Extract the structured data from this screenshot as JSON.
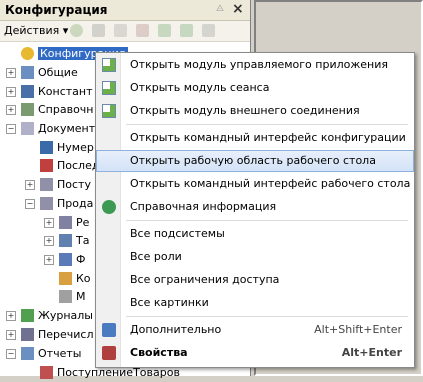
{
  "panel": {
    "title": "Конфигурация",
    "pin": "⨺",
    "close": "×",
    "actions_label": "Действия ▾"
  },
  "tree": [
    {
      "label": "Конфигурация",
      "icon": "config-icon",
      "selected": true
    },
    {
      "label": "Общие",
      "icon": "common-icon"
    },
    {
      "label": "Констант",
      "icon": "constants-icon"
    },
    {
      "label": "Справочн",
      "icon": "catalogs-icon"
    },
    {
      "label": "Документ",
      "icon": "documents-icon"
    },
    {
      "label": "Нумер",
      "icon": "numerator-icon"
    },
    {
      "label": "Послед",
      "icon": "sequence-icon"
    },
    {
      "label": "Посту",
      "icon": "document-icon"
    },
    {
      "label": "Прода",
      "icon": "document-icon"
    },
    {
      "label": "Ре",
      "icon": "attribute-icon"
    },
    {
      "label": "Та",
      "icon": "table-icon"
    },
    {
      "label": "Ф",
      "icon": "form-icon"
    },
    {
      "label": "Ко",
      "icon": "command-icon"
    },
    {
      "label": "М",
      "icon": "layout-icon"
    },
    {
      "label": "Журналы",
      "icon": "journal-icon"
    },
    {
      "label": "Перечисл",
      "icon": "enum-icon"
    },
    {
      "label": "Отчеты",
      "icon": "reports-icon"
    },
    {
      "label": "ПоступлениеТоваров",
      "icon": "report-icon"
    }
  ],
  "menu": {
    "items": [
      {
        "label": "Открыть модуль управляемого приложения",
        "icon": "module-icon"
      },
      {
        "label": "Открыть модуль сеанса",
        "icon": "module-icon"
      },
      {
        "label": "Открыть модуль внешнего соединения",
        "icon": "module-icon"
      },
      {
        "label": "Открыть командный интерфейс конфигурации"
      },
      {
        "label": "Открыть рабочую область рабочего стола",
        "highlighted": true
      },
      {
        "label": "Открыть командный интерфейс рабочего стола"
      },
      {
        "label": "Справочная информация",
        "icon": "help-icon"
      },
      {
        "label": "Все подсистемы"
      },
      {
        "label": "Все роли"
      },
      {
        "label": "Все ограничения доступа"
      },
      {
        "label": "Все картинки"
      },
      {
        "label": "Дополнительно",
        "icon": "advanced-icon",
        "shortcut": "Alt+Shift+Enter"
      },
      {
        "label": "Свойства",
        "icon": "properties-icon",
        "shortcut": "Alt+Enter",
        "bold": true
      }
    ]
  },
  "colors": {
    "selection": "#316ac5",
    "highlight": "#d3e2f7"
  }
}
